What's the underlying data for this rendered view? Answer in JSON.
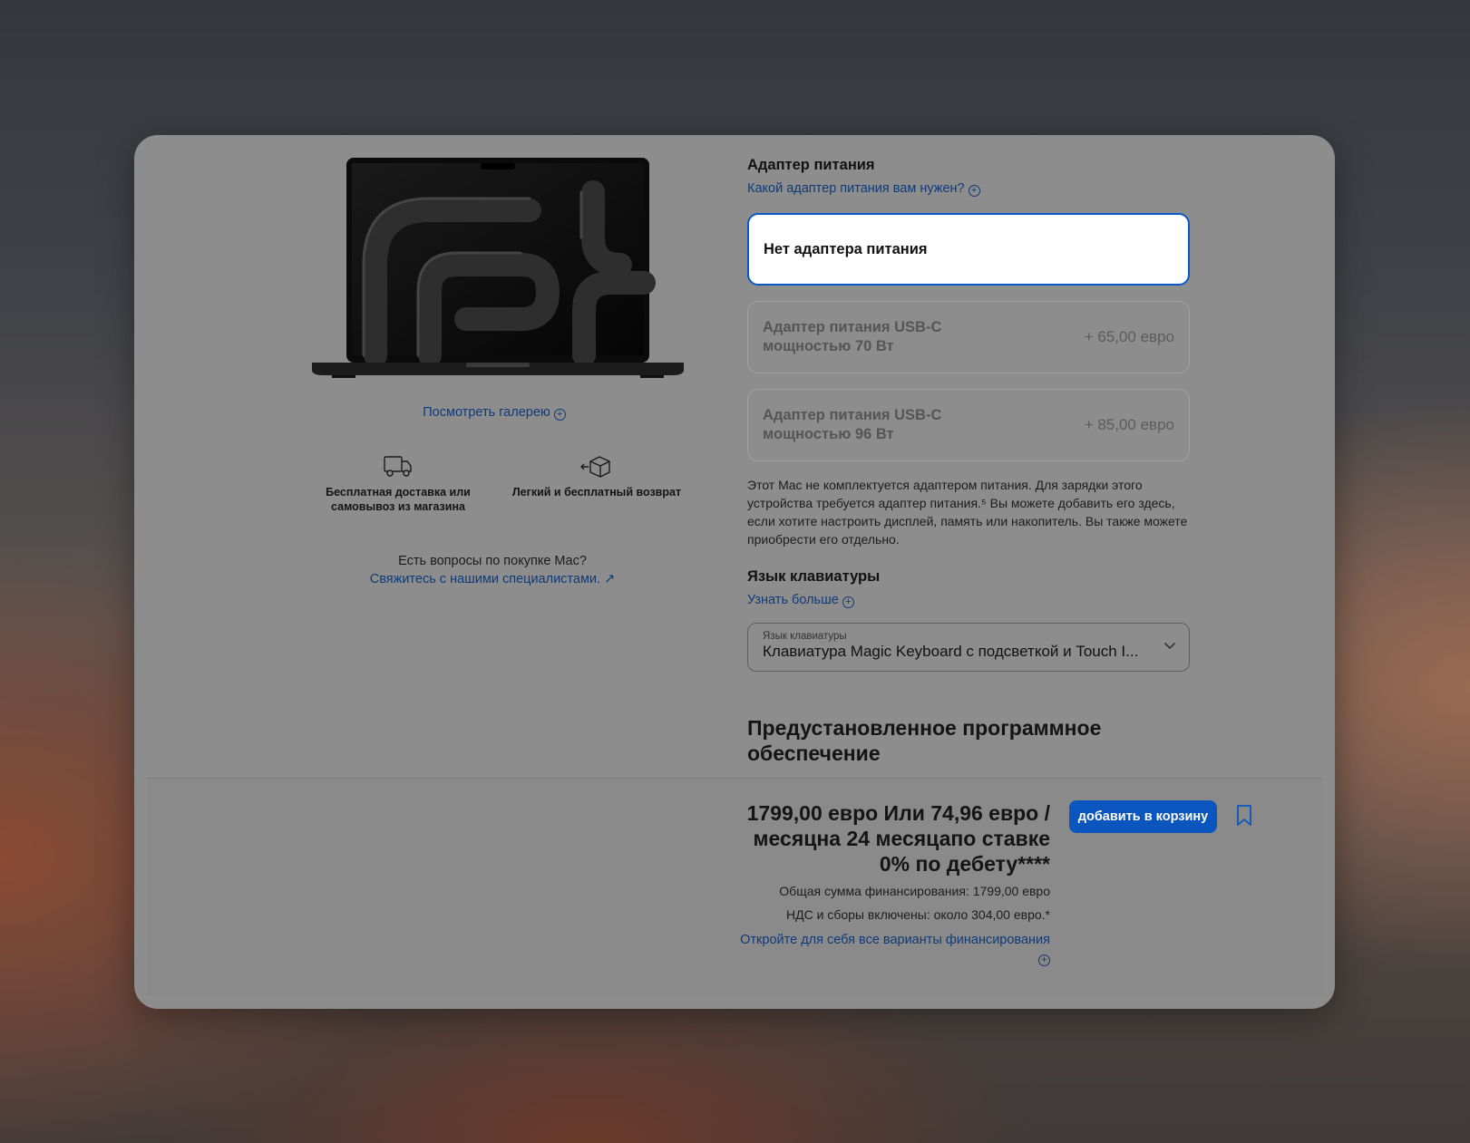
{
  "gallery": {
    "link_label": "Посмотреть галерею"
  },
  "services": [
    {
      "icon": "delivery-truck-icon",
      "label_line1": "Бесплатная доставка или",
      "label_line2": "самовывоз из магазина"
    },
    {
      "icon": "return-box-icon",
      "label_line1": "Легкий и бесплатный возврат"
    }
  ],
  "help": {
    "question": "Есть вопросы по покупке Mac?",
    "contact_link": "Свяжитесь с нашими специалистами. ↗"
  },
  "power_adapter": {
    "heading": "Адаптер питания",
    "help_link": "Какой адаптер питания вам нужен?",
    "options": [
      {
        "label": "Нет адаптера питания",
        "price": "",
        "selected": true
      },
      {
        "label": "Адаптер питания USB-C мощностью 70 Вт",
        "price": "+ 65,00 евро",
        "selected": false
      },
      {
        "label": "Адаптер питания USB-C мощностью 96 Вт",
        "price": "+ 85,00 евро",
        "selected": false
      }
    ],
    "note": "Этот Mac не комплектуется адаптером питания. Для зарядки этого устройства требуется адаптер питания.⁵ Вы можете добавить его здесь, если хотите настроить дисплей, память или накопитель. Вы также можете приобрести его отдельно."
  },
  "keyboard": {
    "heading": "Язык клавиатуры",
    "learn_more": "Узнать больше",
    "select_label": "Язык клавиатуры",
    "select_value": "Клавиатура Magic Keyboard с подсветкой и Touch I..."
  },
  "software": {
    "heading": "Предустановленное программное обеспечение"
  },
  "summary": {
    "price": "1799,00 евро Или 74,96 евро /месяцна 24 месяцапо ставке 0% по дебету****",
    "financing_total": "Общая сумма финансирования: 1799,00 евро",
    "vat": "НДС и сборы включены: около 304,00 евро.*",
    "financing_link": "Откройте для себя все варианты финансирования",
    "add_to_cart": "добавить в корзину"
  },
  "colors": {
    "accent": "#0b55bf",
    "link": "#0f3a7a",
    "overlay_gray": "#8d8d8d"
  }
}
